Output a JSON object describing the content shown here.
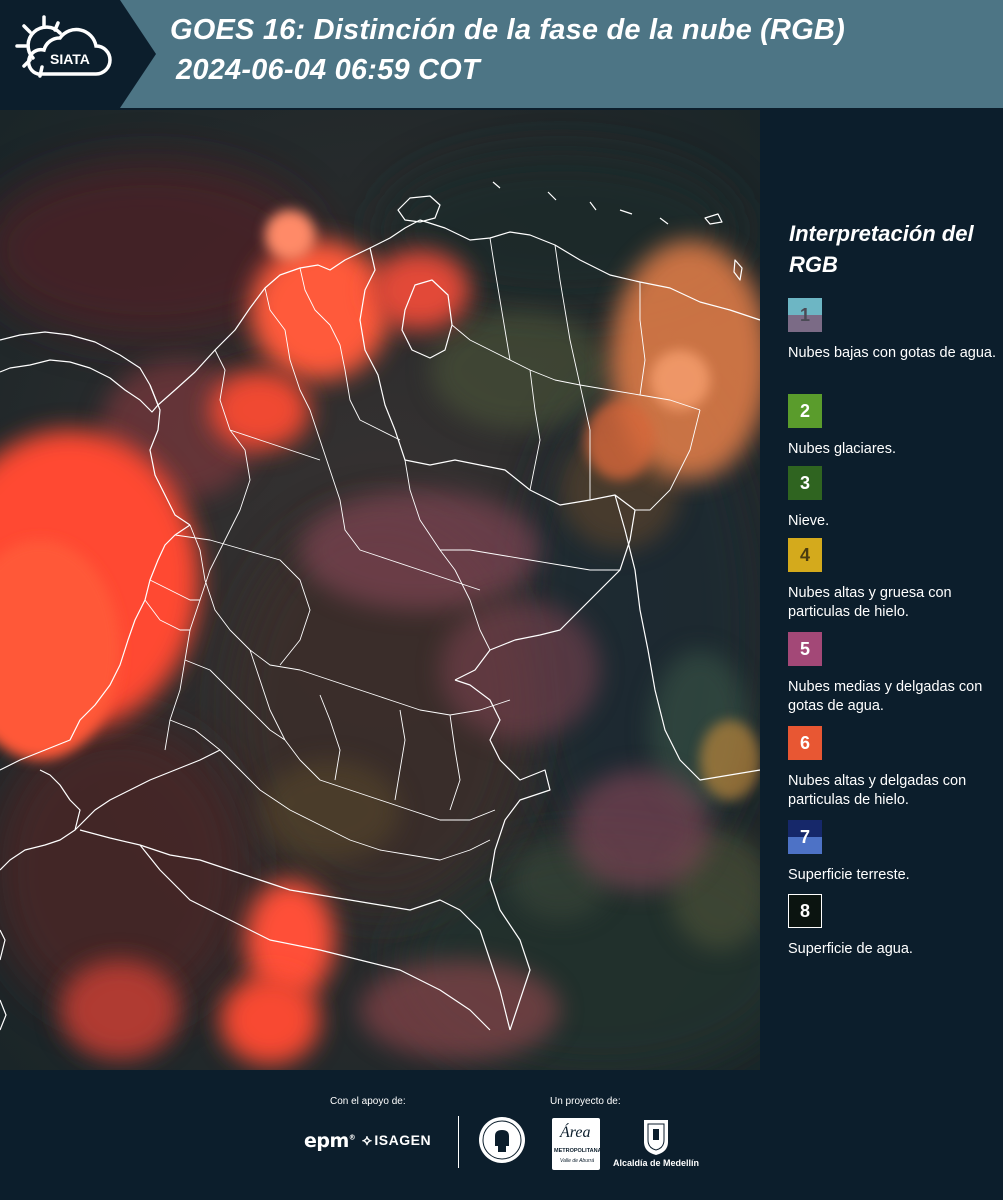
{
  "header": {
    "logo_text": "SIATA",
    "title_line1": "GOES 16: Distinción de la fase de la nube (RGB)",
    "title_line2": "2024-06-04 06:59 COT"
  },
  "legend": {
    "title": "Interpretación del RGB",
    "items": [
      {
        "number": "1",
        "label": "Nubes bajas con gotas de agua.",
        "color_top": "#6db6c4",
        "color_bottom": "#7b6b86",
        "text_color": "#4a4a55"
      },
      {
        "number": "2",
        "label": "Nubes glaciares.",
        "color_top": "#5a9c2c",
        "color_bottom": "#5a9c2c",
        "text_color": "#ffffff"
      },
      {
        "number": "3",
        "label": "Nieve.",
        "color_top": "#2f6420",
        "color_bottom": "#2f6420",
        "text_color": "#ffffff"
      },
      {
        "number": "4",
        "label": "Nubes altas y gruesa con particulas de hielo.",
        "color_top": "#d4aa1c",
        "color_bottom": "#d4aa1c",
        "text_color": "#4a3c10"
      },
      {
        "number": "5",
        "label": "Nubes medias y delgadas con gotas de agua.",
        "color_top": "#a34877",
        "color_bottom": "#a34877",
        "text_color": "#ffffff"
      },
      {
        "number": "6",
        "label": "Nubes altas y delgadas con particulas de hielo.",
        "color_top": "#e85733",
        "color_bottom": "#e85733",
        "text_color": "#ffffff"
      },
      {
        "number": "7",
        "label": "Superficie terreste.",
        "color_top": "#16286a",
        "color_bottom": "#4d72c6",
        "text_color": "#ffffff"
      },
      {
        "number": "8",
        "label": "Superficie de agua.",
        "color_top": "#0b1410",
        "color_bottom": "#0b1410",
        "text_color": "#ffffff"
      }
    ]
  },
  "footer": {
    "support_label": "Con el apoyo de:",
    "project_label": "Un proyecto de:",
    "epm": "epm",
    "isagen": "ISAGEN",
    "area_word": "Área",
    "area_sub1": "METROPOLITANA",
    "area_sub2": "Valle de Aburrá",
    "alcaldia": "Alcaldía de Medellín"
  },
  "colors": {
    "background": "#0c1e2c",
    "header_band": "#4d7585",
    "convective_red": "#ff4a30"
  }
}
